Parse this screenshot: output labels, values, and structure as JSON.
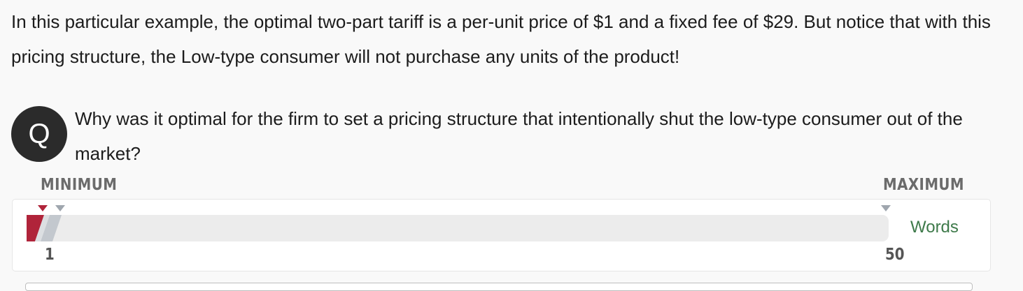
{
  "intro_text": "In this particular example, the optimal two-part tariff is a per-unit price of $1 and a fixed fee of $29. But notice that with this pricing structure, the Low-type consumer will not purchase any units of the product!",
  "question": {
    "badge": "Q",
    "text": "Why was it optimal for the firm to set a pricing structure that intentionally shut the low-type consumer out of the market?"
  },
  "word_meter": {
    "minimum_label": "MINIMUM",
    "maximum_label": "MAXIMUM",
    "min_value": "1",
    "max_value": "50",
    "unit_label": "Words",
    "current_count": 0,
    "colors": {
      "current_marker": "#b0243a",
      "limit_marker": "#9fa6ae",
      "track": "#ececec",
      "unit_text": "#3e7a4a"
    }
  }
}
